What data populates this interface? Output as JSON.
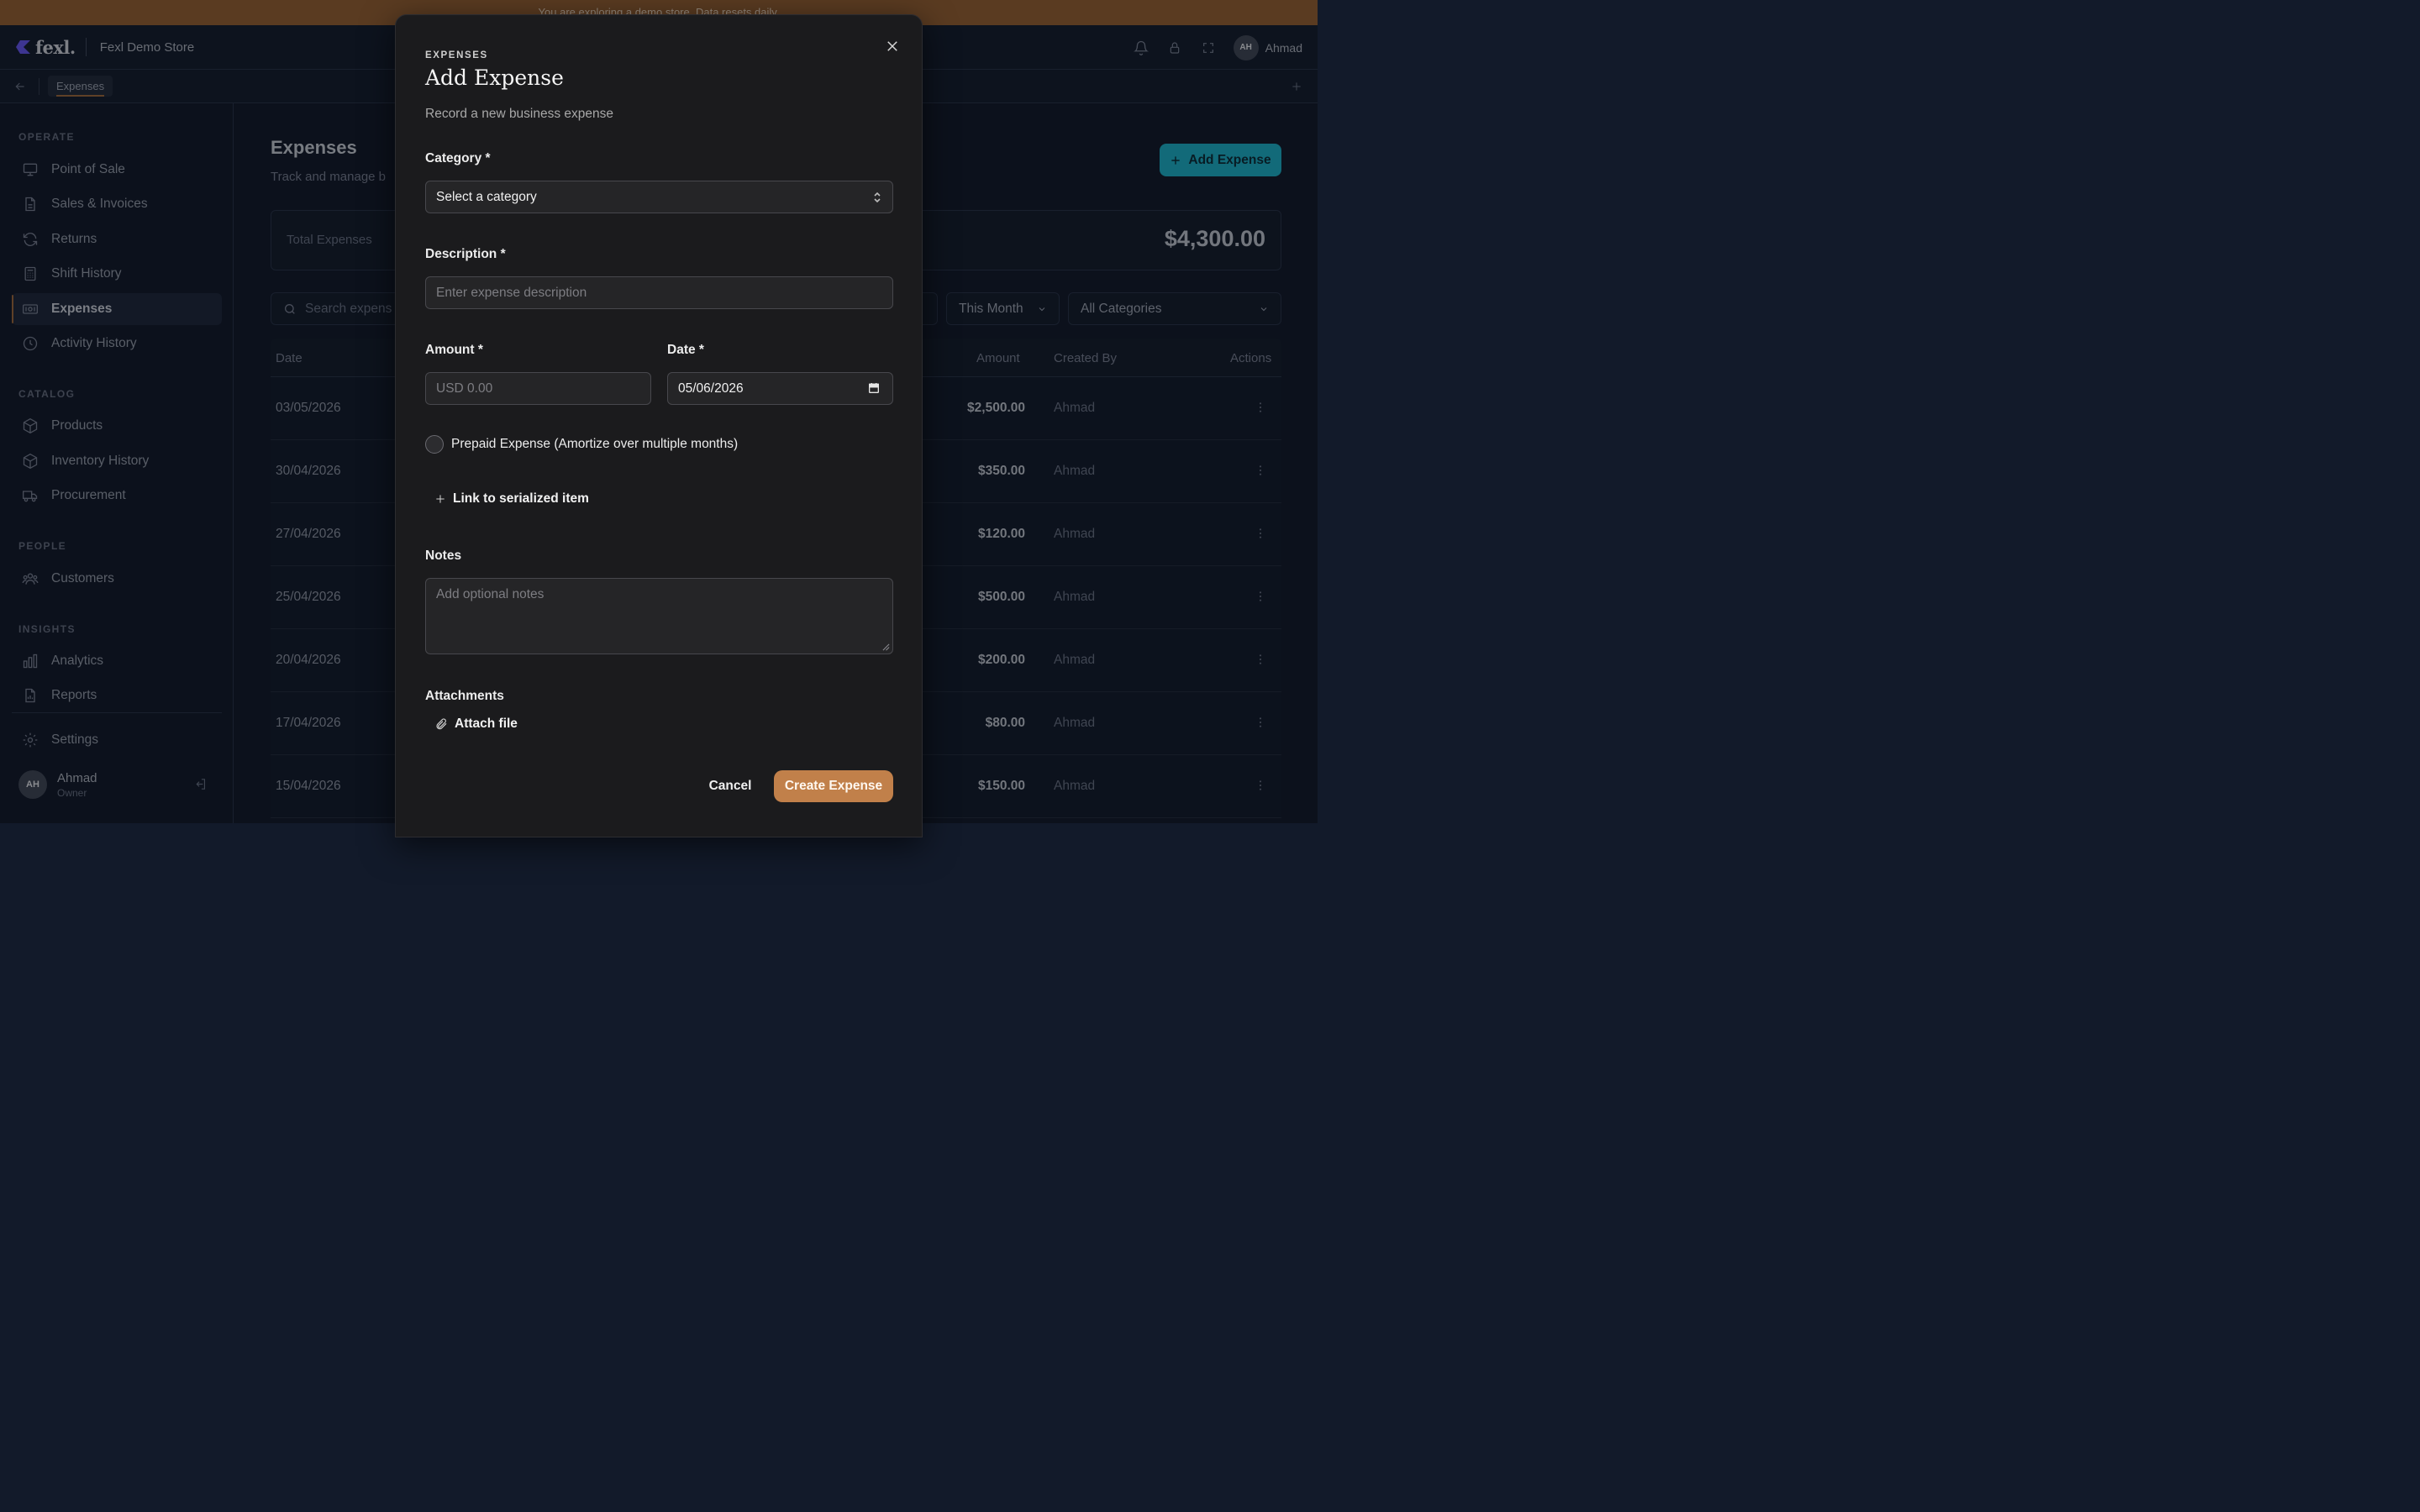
{
  "banner": {
    "text": "You are exploring a demo store. Data resets daily."
  },
  "header": {
    "logo_text": "fexl.",
    "store_name": "Fexl Demo Store",
    "user_initials": "AH",
    "user_name": "Ahmad"
  },
  "tabs": [
    {
      "label": "Expenses"
    }
  ],
  "sidebar": {
    "sections": {
      "operate": "OPERATE",
      "catalog": "CATALOG",
      "people": "PEOPLE",
      "insights": "INSIGHTS"
    },
    "items": [
      {
        "label": "Point of Sale",
        "icon": "monitor-icon"
      },
      {
        "label": "Sales & Invoices",
        "icon": "document-icon"
      },
      {
        "label": "Returns",
        "icon": "refresh-icon"
      },
      {
        "label": "Shift History",
        "icon": "calculator-icon"
      },
      {
        "label": "Expenses",
        "icon": "banknote-icon",
        "active": true
      },
      {
        "label": "Activity History",
        "icon": "clock-icon"
      },
      {
        "label": "Products",
        "icon": "box-icon"
      },
      {
        "label": "Inventory History",
        "icon": "box-icon"
      },
      {
        "label": "Procurement",
        "icon": "truck-icon"
      },
      {
        "label": "Customers",
        "icon": "users-icon"
      },
      {
        "label": "Analytics",
        "icon": "bar-chart-icon"
      },
      {
        "label": "Reports",
        "icon": "report-icon"
      },
      {
        "label": "Settings",
        "icon": "gear-icon"
      }
    ],
    "user": {
      "initials": "AH",
      "name": "Ahmad",
      "role": "Owner"
    }
  },
  "main": {
    "title": "Expenses",
    "subtitle": "Track and manage b",
    "add_button": "Add Expense",
    "total_label": "Total Expenses",
    "total_value": "$4,300.00",
    "search_placeholder": "Search expens",
    "filter_period": "This Month",
    "filter_category": "All Categories",
    "columns": {
      "date": "Date",
      "amount": "Amount",
      "created_by": "Created By",
      "actions": "Actions"
    },
    "rows": [
      {
        "date": "03/05/2026",
        "amount": "$2,500.00",
        "created_by": "Ahmad"
      },
      {
        "date": "30/04/2026",
        "amount": "$350.00",
        "created_by": "Ahmad"
      },
      {
        "date": "27/04/2026",
        "amount": "$120.00",
        "created_by": "Ahmad"
      },
      {
        "date": "25/04/2026",
        "amount": "$500.00",
        "created_by": "Ahmad"
      },
      {
        "date": "20/04/2026",
        "amount": "$200.00",
        "created_by": "Ahmad"
      },
      {
        "date": "17/04/2026",
        "amount": "$80.00",
        "created_by": "Ahmad"
      },
      {
        "date": "15/04/2026",
        "amount": "$150.00",
        "created_by": "Ahmad"
      }
    ]
  },
  "modal": {
    "eyebrow": "EXPENSES",
    "title": "Add Expense",
    "subtitle": "Record a new business expense",
    "category_label": "Category *",
    "category_placeholder": "Select a category",
    "description_label": "Description *",
    "description_placeholder": "Enter expense description",
    "amount_label": "Amount *",
    "amount_placeholder": "USD 0.00",
    "date_label": "Date *",
    "date_value": "05/06/2026",
    "prepaid_label": "Prepaid Expense (Amortize over multiple months)",
    "link_serialized": "Link to serialized item",
    "notes_label": "Notes",
    "notes_placeholder": "Add optional notes",
    "attachments_label": "Attachments",
    "attach_file": "Attach file",
    "cancel": "Cancel",
    "create": "Create Expense"
  },
  "colors": {
    "accent_brand": "#c1804a",
    "primary_teal": "#1b9cb3",
    "banner": "#855731"
  }
}
